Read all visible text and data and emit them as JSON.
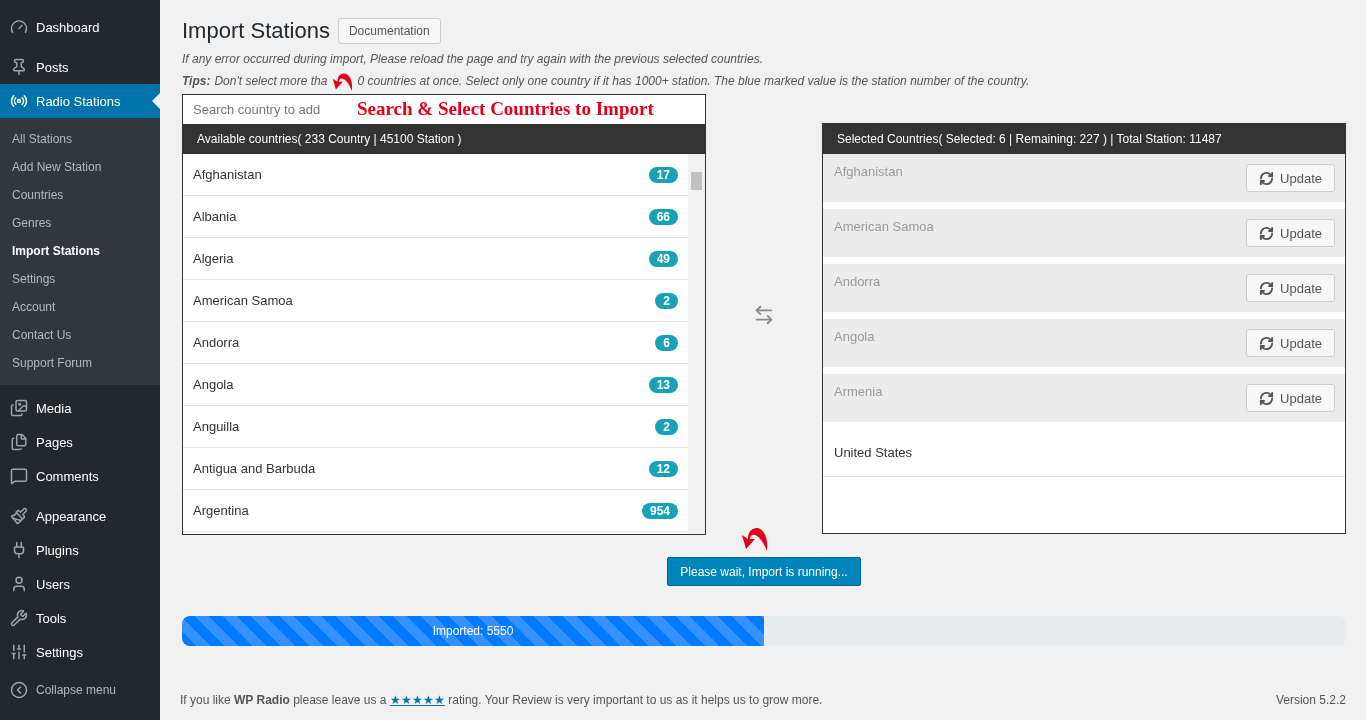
{
  "sidebar": {
    "items": [
      {
        "label": "Dashboard",
        "selected": false
      },
      {
        "label": "Posts",
        "selected": false
      },
      {
        "label": "Radio Stations",
        "selected": true,
        "children": [
          {
            "label": "All Stations",
            "selected": false
          },
          {
            "label": "Add New Station",
            "selected": false
          },
          {
            "label": "Countries",
            "selected": false
          },
          {
            "label": "Genres",
            "selected": false
          },
          {
            "label": "Import Stations",
            "selected": true
          },
          {
            "label": "Settings",
            "selected": false
          },
          {
            "label": "Account",
            "selected": false
          },
          {
            "label": "Contact Us",
            "selected": false
          },
          {
            "label": "Support Forum",
            "selected": false
          }
        ]
      },
      {
        "label": "Media",
        "selected": false
      },
      {
        "label": "Pages",
        "selected": false
      },
      {
        "label": "Comments",
        "selected": false
      },
      {
        "label": "Appearance",
        "selected": false
      },
      {
        "label": "Plugins",
        "selected": false
      },
      {
        "label": "Users",
        "selected": false
      },
      {
        "label": "Tools",
        "selected": false
      },
      {
        "label": "Settings",
        "selected": false
      }
    ],
    "collapse_label": "Collapse menu"
  },
  "page": {
    "title": "Import Stations",
    "documentation_button": "Documentation",
    "notice": "If any error occurred during import, Please reload the page and try again with the previous selected countries.",
    "tips_label": "Tips:",
    "tips_before": "Don't select more tha",
    "tips_after": "0 countries at once. Select only one country if it has 1000+ station. The blue marked value is the station number of the country."
  },
  "annotations": {
    "search_callout": "Search & Select Countries to Import"
  },
  "available": {
    "search": {
      "placeholder": "Search country to add"
    },
    "header": "Available countries( 233 Country | 45100 Station )",
    "rows": [
      {
        "name": "Afghanistan",
        "count": "17"
      },
      {
        "name": "Albania",
        "count": "66"
      },
      {
        "name": "Algeria",
        "count": "49"
      },
      {
        "name": "American Samoa",
        "count": "2"
      },
      {
        "name": "Andorra",
        "count": "6"
      },
      {
        "name": "Angola",
        "count": "13"
      },
      {
        "name": "Anguilla",
        "count": "2"
      },
      {
        "name": "Antigua and Barbuda",
        "count": "12"
      },
      {
        "name": "Argentina",
        "count": "954"
      }
    ]
  },
  "selected": {
    "header": "Selected Countries( Selected: 6 | Remaining: 227 ) | Total Station: 11487",
    "rows": [
      {
        "name": "Afghanistan",
        "done": true,
        "button": "Update"
      },
      {
        "name": "American Samoa",
        "done": true,
        "button": "Update"
      },
      {
        "name": "Andorra",
        "done": true,
        "button": "Update"
      },
      {
        "name": "Angola",
        "done": true,
        "button": "Update"
      },
      {
        "name": "Armenia",
        "done": true,
        "button": "Update"
      },
      {
        "name": "United States",
        "done": false
      }
    ]
  },
  "import_button": "Please wait, Import is running...",
  "progress": {
    "level": 0.5,
    "label": "Imported: 5550"
  },
  "footer": {
    "before": "If you like **WP Radio** please leave us a",
    "link": "★★★★★",
    "after": "rating. Your Review is very important to us as it helps us to grow more.",
    "version": "Version 5.2.2"
  }
}
